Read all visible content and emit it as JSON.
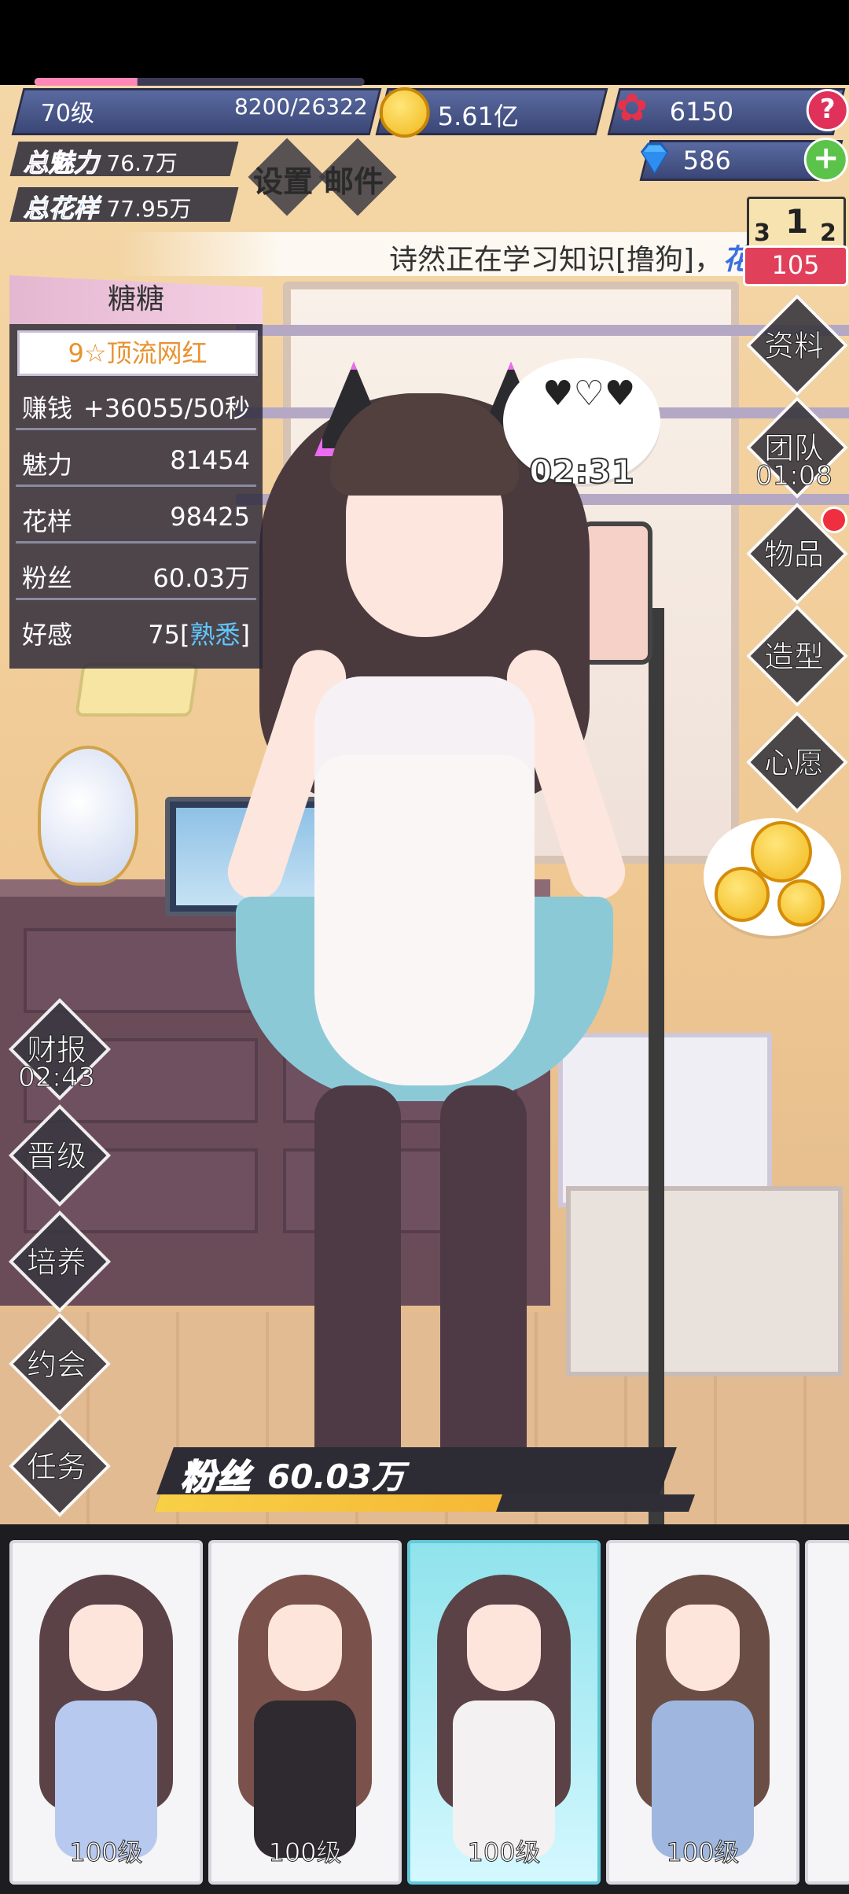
{
  "hud": {
    "level_label": "70级",
    "exp_text": "8200/26322",
    "exp_progress": 0.3115,
    "gold": "5.61亿",
    "roses": "6150",
    "diamonds": "586",
    "help_glyph": "?",
    "plus_glyph": "+"
  },
  "stats": {
    "charm_label": "总魅力",
    "charm_value": "76.7万",
    "style_label": "总花样",
    "style_value": "77.95万"
  },
  "top_menu": {
    "settings": "设置",
    "mail": "邮件"
  },
  "ticker": {
    "text": "诗然正在学习知识[撸狗]，",
    "suffix": "花"
  },
  "rank": {
    "first": "1",
    "second": "2",
    "third": "3",
    "value": "105"
  },
  "character_card": {
    "name": "糖糖",
    "title": "9☆顶流网红",
    "rows": [
      {
        "key": "赚钱",
        "value": "+36055/50秒"
      },
      {
        "key": "魅力",
        "value": "81454"
      },
      {
        "key": "花样",
        "value": "98425"
      },
      {
        "key": "粉丝",
        "value": "60.03万"
      },
      {
        "key": "好感",
        "value": "75",
        "tag": "熟悉"
      }
    ]
  },
  "bubble": {
    "timer": "02:31"
  },
  "right_menu": [
    {
      "label": "资料"
    },
    {
      "label": "团队",
      "sub": "01:08"
    },
    {
      "label": "物品"
    },
    {
      "label": "造型"
    },
    {
      "label": "心愿"
    }
  ],
  "left_menu": [
    {
      "label": "财报",
      "sub": "02:43"
    },
    {
      "label": "晋级"
    },
    {
      "label": "培养"
    },
    {
      "label": "约会"
    },
    {
      "label": "任务"
    }
  ],
  "fans_bar": {
    "label": "粉丝",
    "value": "60.03万",
    "progress": 0.64
  },
  "carousel": [
    {
      "level": "100级"
    },
    {
      "level": "100级"
    },
    {
      "level": "100级",
      "selected": true
    },
    {
      "level": "100级"
    }
  ],
  "colors": {
    "accent_purple": "#a779f5",
    "accent_pink": "#ff87b8",
    "gold": "#f1b81a",
    "rank_red": "#e0405a"
  }
}
